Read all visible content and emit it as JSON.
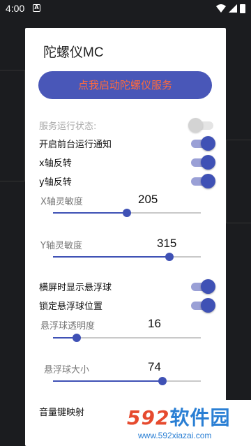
{
  "status_bar": {
    "time": "4:00",
    "notification_icon": "A"
  },
  "dialog": {
    "title": "陀螺仪MC",
    "start_button_label": "点我启动陀螺仪服务",
    "toggles": [
      {
        "label": "服务运行状态:",
        "on": false,
        "disabled": true
      },
      {
        "label": "开启前台运行通知",
        "on": true
      },
      {
        "label": "x轴反转",
        "on": true
      },
      {
        "label": "y轴反转",
        "on": true
      },
      {
        "label": "横屏时显示悬浮球",
        "on": true
      },
      {
        "label": "锁定悬浮球位置",
        "on": true
      },
      {
        "label": "音量键映射",
        "on": true
      }
    ],
    "sliders": [
      {
        "label": "X轴灵敏度",
        "value": "205",
        "fraction": 0.5
      },
      {
        "label": "Y轴灵敏度",
        "value": "315",
        "fraction": 0.79
      },
      {
        "label": "悬浮球透明度",
        "value": "16",
        "fraction": 0.16
      },
      {
        "label": "悬浮球大小",
        "value": "74",
        "fraction": 0.74
      }
    ]
  },
  "watermark": {
    "brand_numbers": "592",
    "brand_text": "软件园",
    "url": "www.592xiazai.com"
  },
  "colors": {
    "accent": "#3f51b5",
    "button_text": "#ff6a3d",
    "watermark_blue": "#2a7fd4",
    "watermark_red": "#e64a2e"
  }
}
